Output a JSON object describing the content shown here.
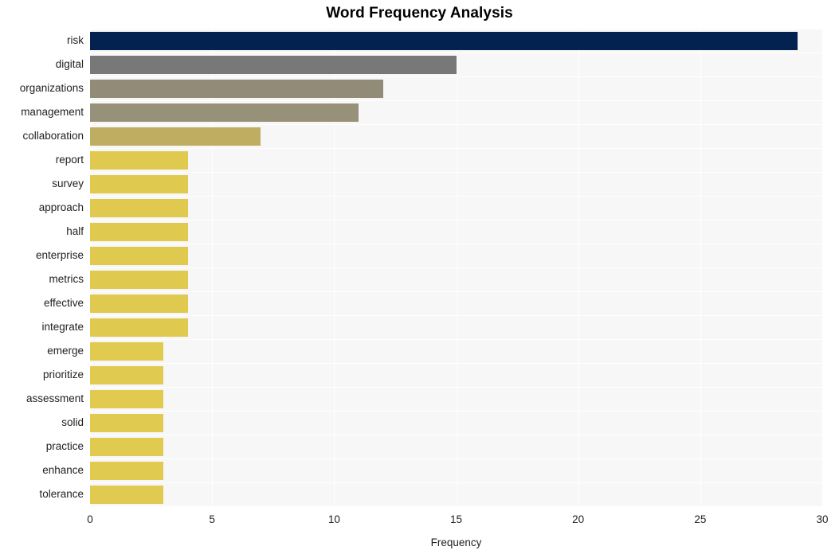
{
  "chart_data": {
    "type": "bar",
    "orientation": "horizontal",
    "title": "Word Frequency Analysis",
    "xlabel": "Frequency",
    "ylabel": "",
    "xlim": [
      0,
      30
    ],
    "xticks": [
      0,
      5,
      10,
      15,
      20,
      25,
      30
    ],
    "xtick_labels": [
      "0",
      "5",
      "10",
      "15",
      "20",
      "25",
      "30"
    ],
    "grid": true,
    "legend": "none",
    "categories": [
      "risk",
      "digital",
      "organizations",
      "management",
      "collaboration",
      "report",
      "survey",
      "approach",
      "half",
      "enterprise",
      "metrics",
      "effective",
      "integrate",
      "emerge",
      "prioritize",
      "assessment",
      "solid",
      "practice",
      "enhance",
      "tolerance"
    ],
    "values": [
      29,
      15,
      12,
      11,
      7,
      4,
      4,
      4,
      4,
      4,
      4,
      4,
      4,
      3,
      3,
      3,
      3,
      3,
      3,
      3
    ],
    "bar_colors": [
      "#032250",
      "#787878",
      "#918B77",
      "#98917A",
      "#bfae61",
      "#dfc94f",
      "#dfc94f",
      "#dfc94f",
      "#dfc94f",
      "#dfc94f",
      "#dfc94f",
      "#dfc94f",
      "#dfc94f",
      "#e0ca50",
      "#e0ca50",
      "#e0ca50",
      "#e0ca50",
      "#e0ca50",
      "#e0ca50",
      "#e0ca50"
    ],
    "plot_background": "#f7f7f7",
    "gridline_color": "#ffffff",
    "figure_background": "#ffffff"
  }
}
